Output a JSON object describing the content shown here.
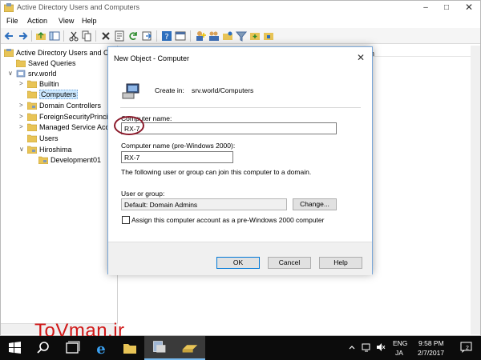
{
  "window": {
    "title": "Active Directory Users and Computers",
    "controls": {
      "minimize": "–",
      "maximize": "□",
      "close": "✕"
    }
  },
  "menubar": {
    "items": [
      "File",
      "Action",
      "View",
      "Help"
    ]
  },
  "toolbar": {
    "icons": [
      "back-icon",
      "forward-icon",
      "up-folder-icon",
      "show-hide-tree-icon",
      "cut-icon",
      "copy-icon",
      "delete-icon",
      "properties-icon",
      "refresh-icon",
      "export-list-icon",
      "help-icon",
      "console-icon",
      "new-user-icon",
      "new-group-icon",
      "filter-icon",
      "add-to-group-icon",
      "ou-icon"
    ]
  },
  "tree": {
    "root": "Active Directory Users and Com",
    "items": [
      {
        "label": "Saved Queries",
        "level": 1,
        "expander": ""
      },
      {
        "label": "srv.world",
        "level": 1,
        "expander": "∨"
      },
      {
        "label": "Builtin",
        "level": 2,
        "expander": ">"
      },
      {
        "label": "Computers",
        "level": 2,
        "expander": "",
        "selected": true
      },
      {
        "label": "Domain Controllers",
        "level": 2,
        "expander": ">"
      },
      {
        "label": "ForeignSecurityPrincip",
        "level": 2,
        "expander": ">"
      },
      {
        "label": "Managed Service Acco",
        "level": 2,
        "expander": ">"
      },
      {
        "label": "Users",
        "level": 2,
        "expander": ""
      },
      {
        "label": "Hiroshima",
        "level": 2,
        "expander": "∨"
      },
      {
        "label": "Development01",
        "level": 3,
        "expander": ""
      }
    ]
  },
  "right_pane": {
    "header_fragment": "n"
  },
  "dialog": {
    "title": "New Object - Computer",
    "close": "✕",
    "create_in_label": "Create in:",
    "create_in_value": "srv.world/Computers",
    "computer_name_label": "Computer name:",
    "computer_name_value": "RX-7",
    "pre2000_label": "Computer name (pre-Windows 2000):",
    "pre2000_value": "RX-7",
    "join_note": "The following user or group can join this computer to a domain.",
    "user_group_label": "User or group:",
    "user_group_value": "Default: Domain Admins",
    "change_button": "Change...",
    "checkbox_label": "Assign this computer account as a pre-Windows 2000 computer",
    "checkbox_checked": false,
    "ok_button": "OK",
    "cancel_button": "Cancel",
    "help_button": "Help"
  },
  "watermark": "ToVman.ir",
  "taskbar": {
    "lang_top": "ENG",
    "lang_bottom": "JA",
    "time": "9:58 PM",
    "date": "2/7/2017",
    "notifications_count": "2"
  },
  "colors": {
    "accent": "#0078d7",
    "selection": "#cce8ff",
    "annotation": "#8b1a2b",
    "watermark": "#d01818",
    "taskbar": "#0c0c0c"
  }
}
